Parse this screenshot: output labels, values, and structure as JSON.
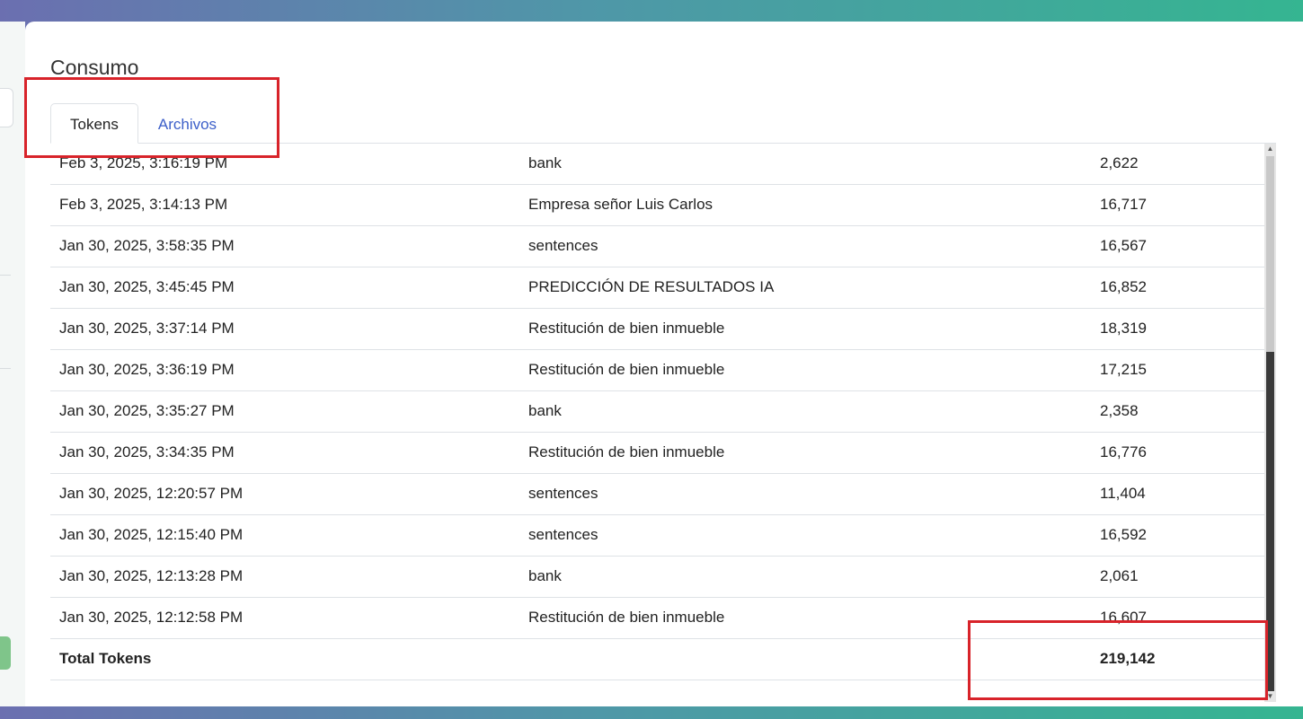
{
  "page": {
    "title": "Consumo"
  },
  "tabs": [
    {
      "label": "Tokens",
      "active": true
    },
    {
      "label": "Archivos",
      "active": false
    }
  ],
  "table": {
    "rows": [
      {
        "date": "Feb 3, 2025, 3:16:19 PM",
        "name": "bank",
        "tokens": "2,622"
      },
      {
        "date": "Feb 3, 2025, 3:14:13 PM",
        "name": "Empresa señor Luis Carlos",
        "tokens": "16,717"
      },
      {
        "date": "Jan 30, 2025, 3:58:35 PM",
        "name": "sentences",
        "tokens": "16,567"
      },
      {
        "date": "Jan 30, 2025, 3:45:45 PM",
        "name": "PREDICCIÓN DE RESULTADOS IA",
        "tokens": "16,852"
      },
      {
        "date": "Jan 30, 2025, 3:37:14 PM",
        "name": "Restitución de bien inmueble",
        "tokens": "18,319"
      },
      {
        "date": "Jan 30, 2025, 3:36:19 PM",
        "name": "Restitución de bien inmueble",
        "tokens": "17,215"
      },
      {
        "date": "Jan 30, 2025, 3:35:27 PM",
        "name": "bank",
        "tokens": "2,358"
      },
      {
        "date": "Jan 30, 2025, 3:34:35 PM",
        "name": "Restitución de bien inmueble",
        "tokens": "16,776"
      },
      {
        "date": "Jan 30, 2025, 12:20:57 PM",
        "name": "sentences",
        "tokens": "11,404"
      },
      {
        "date": "Jan 30, 2025, 12:15:40 PM",
        "name": "sentences",
        "tokens": "16,592"
      },
      {
        "date": "Jan 30, 2025, 12:13:28 PM",
        "name": "bank",
        "tokens": "2,061"
      },
      {
        "date": "Jan 30, 2025, 12:12:58 PM",
        "name": "Restitución de bien inmueble",
        "tokens": "16,607"
      }
    ],
    "total_label": "Total Tokens",
    "total_value": "219,142"
  },
  "colors": {
    "highlight": "#d8232a",
    "tab_link": "#3c5fc9"
  }
}
